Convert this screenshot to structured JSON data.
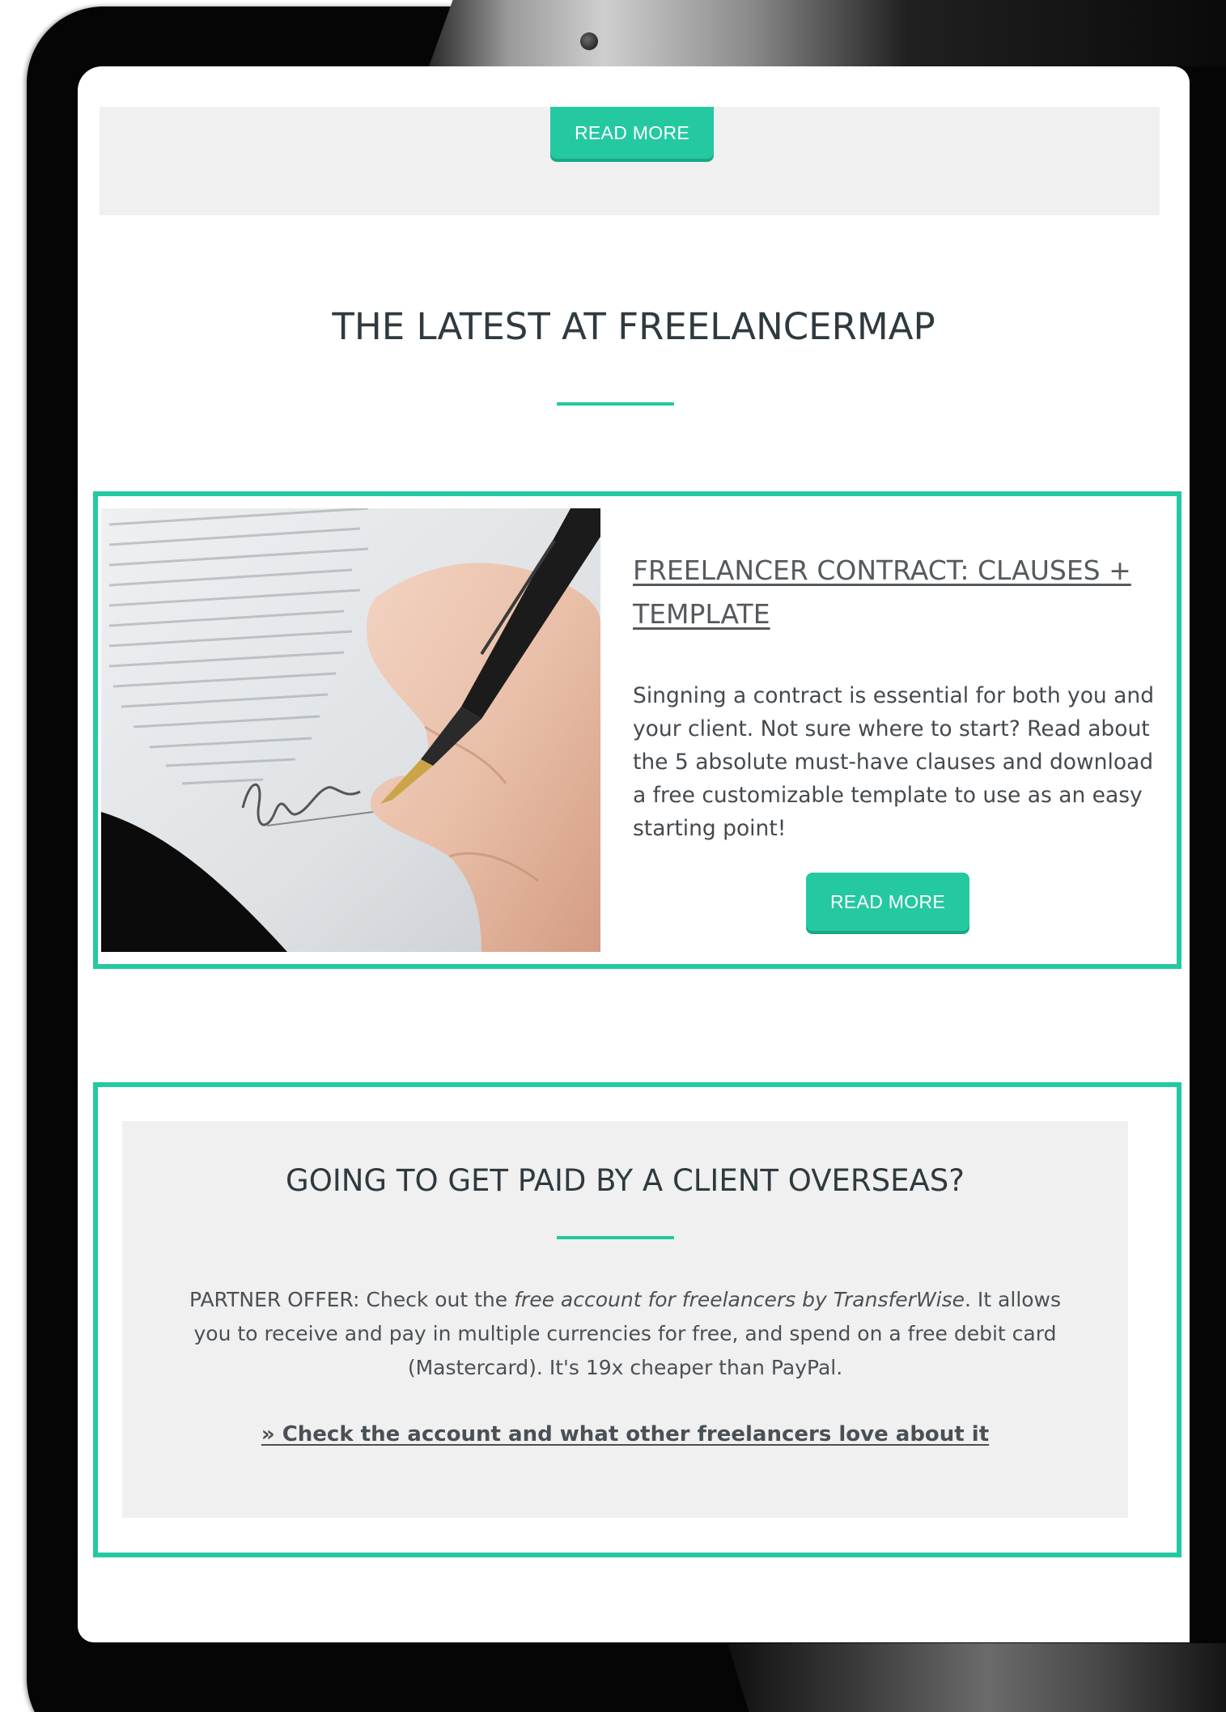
{
  "top_section": {
    "read_more_label": "READ MORE"
  },
  "latest": {
    "heading": "THE LATEST AT FREELANCERMAP",
    "article": {
      "title": "FREELANCER CONTRACT: CLAUSES + TEMPLATE",
      "description": "Singning a contract is essential for both you and your client. Not sure where to start? Read about the 5 absolute must-have clauses and download a free customizable template to use as an easy starting point!",
      "read_more_label": "READ MORE",
      "image_subject": "hand-signing-contract"
    }
  },
  "offer": {
    "heading": "GOING TO GET PAID BY A CLIENT OVERSEAS?",
    "text_before": "PARTNER OFFER: Check out the ",
    "text_emphasis": "free account for freelancers by TransferWise",
    "text_after": ". It allows you to receive and pay in multiple currencies for free, and spend on a free debit card (Mastercard). It's 19x cheaper than PayPal.",
    "link_label": "» Check the account and what other freelancers love about it"
  },
  "colors": {
    "accent": "#24c9a1",
    "heading_text": "#2f3a40",
    "body_text": "#444a4f",
    "panel_bg": "#f0f0f0",
    "tablet_frame": "#050505"
  }
}
